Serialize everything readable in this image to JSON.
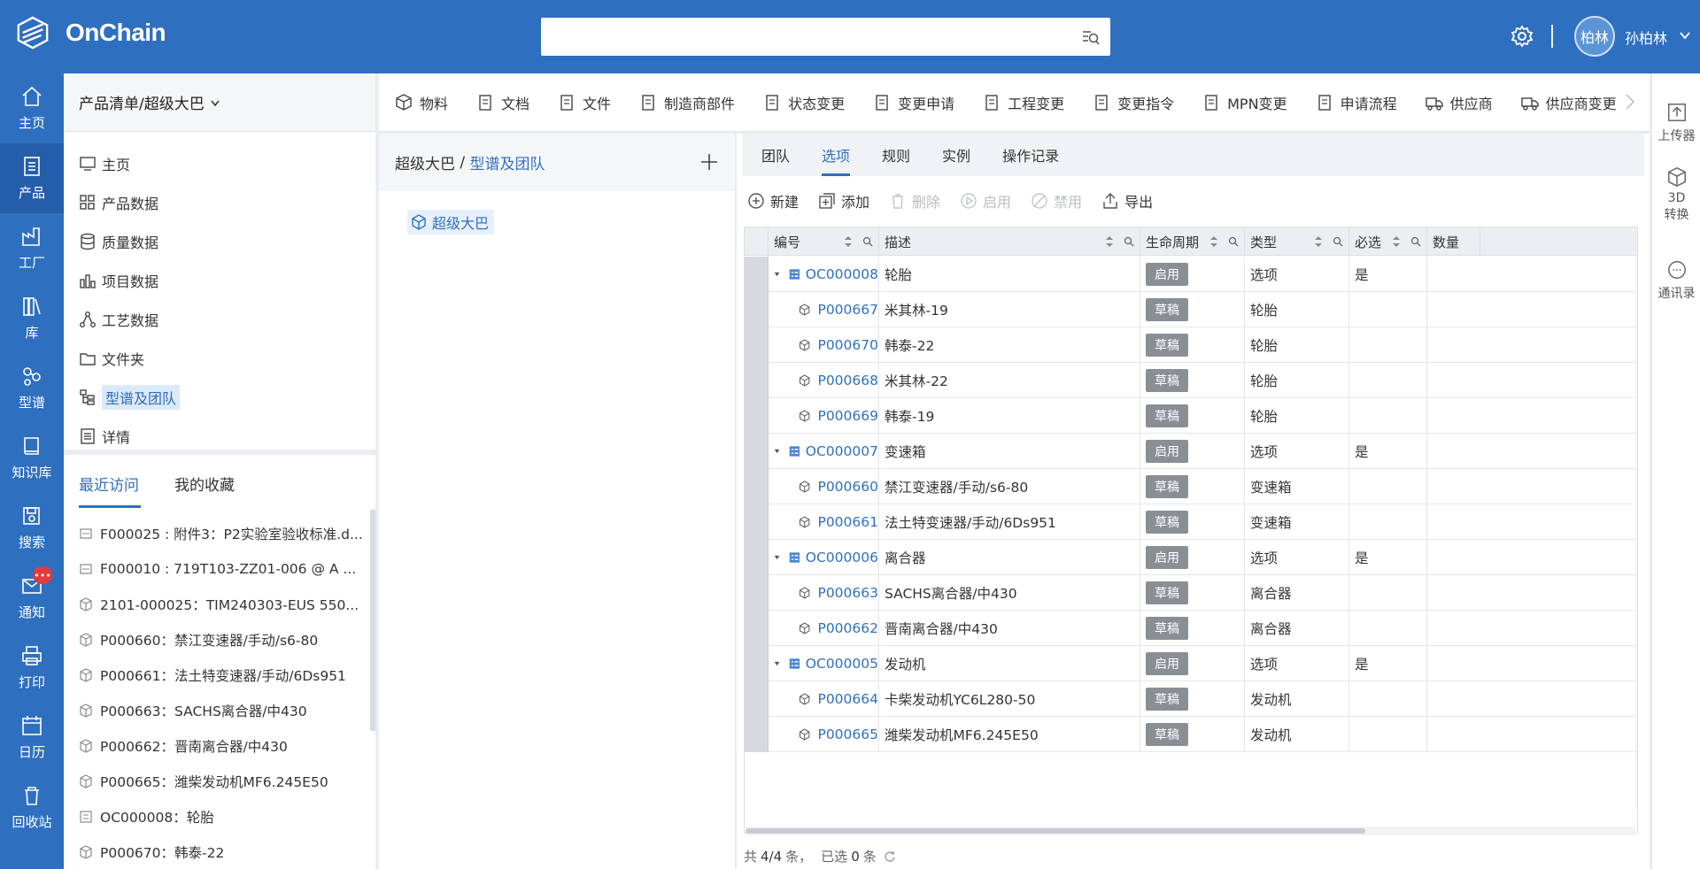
{
  "app": {
    "name": "OnChain"
  },
  "search": {
    "placeholder": ""
  },
  "user": {
    "avatar_text": "柏林",
    "name": "孙柏林"
  },
  "nav_rail": [
    {
      "label": "主页",
      "icon": "home-icon"
    },
    {
      "label": "产品",
      "icon": "product-icon"
    },
    {
      "label": "工厂",
      "icon": "factory-icon"
    },
    {
      "label": "库",
      "icon": "library-icon"
    },
    {
      "label": "型谱",
      "icon": "spectrum-icon"
    },
    {
      "label": "知识库",
      "icon": "book-icon"
    },
    {
      "label": "搜索",
      "icon": "search-save-icon"
    },
    {
      "label": "通知",
      "icon": "mail-icon"
    },
    {
      "label": "打印",
      "icon": "printer-icon"
    },
    {
      "label": "日历",
      "icon": "calendar-icon"
    },
    {
      "label": "回收站",
      "icon": "trash-icon"
    }
  ],
  "notification_badge": "•••",
  "sidebar": {
    "header": "产品清单/超级大巴",
    "items": [
      {
        "label": "主页"
      },
      {
        "label": "产品数据"
      },
      {
        "label": "质量数据"
      },
      {
        "label": "项目数据"
      },
      {
        "label": "工艺数据"
      },
      {
        "label": "文件夹"
      },
      {
        "label": "型谱及团队"
      },
      {
        "label": "详情"
      }
    ],
    "recent_tabs": [
      "最近访问",
      "我的收藏"
    ],
    "recent": [
      "F000025 : 附件3：P2实验室验收标准.d...",
      "F000010 : 719T103-ZZ01-006 @ A ...",
      "2101-000025：TIM240303-EUS 550...",
      "P000660：禁江变速器/手动/s6-80",
      "P000661：法土特变速器/手动/6Ds951",
      "P000663：SACHS离合器/中430",
      "P000662：晋南离合器/中430",
      "P000665：潍柴发动机MF6.245E50",
      "OC000008：轮胎",
      "P000670：韩泰-22"
    ]
  },
  "toolbar": [
    "物料",
    "文档",
    "文件",
    "制造商部件",
    "状态变更",
    "变更申请",
    "工程变更",
    "变更指令",
    "MPN变更",
    "申请流程",
    "供应商",
    "供应商变更"
  ],
  "breadcrumb": {
    "root": "超级大巴",
    "sep": " / ",
    "current": "型谱及团队"
  },
  "tree": {
    "node": "超级大巴"
  },
  "tabs": [
    "团队",
    "选项",
    "规则",
    "实例",
    "操作记录"
  ],
  "actions": [
    {
      "label": "新建",
      "enabled": true
    },
    {
      "label": "添加",
      "enabled": true
    },
    {
      "label": "删除",
      "enabled": false
    },
    {
      "label": "启用",
      "enabled": false
    },
    {
      "label": "禁用",
      "enabled": false
    },
    {
      "label": "导出",
      "enabled": true
    }
  ],
  "columns": [
    "编号",
    "描述",
    "生命周期",
    "类型",
    "必选",
    "数量"
  ],
  "rows": [
    {
      "kind": "option",
      "code": "OC000008",
      "desc": "轮胎",
      "state": "启用",
      "type": "选项",
      "required": "是"
    },
    {
      "kind": "part",
      "code": "P000667",
      "desc": "米其林-19",
      "state": "草稿",
      "type": "轮胎",
      "required": ""
    },
    {
      "kind": "part",
      "code": "P000670",
      "desc": "韩泰-22",
      "state": "草稿",
      "type": "轮胎",
      "required": ""
    },
    {
      "kind": "part",
      "code": "P000668",
      "desc": "米其林-22",
      "state": "草稿",
      "type": "轮胎",
      "required": ""
    },
    {
      "kind": "part",
      "code": "P000669",
      "desc": "韩泰-19",
      "state": "草稿",
      "type": "轮胎",
      "required": ""
    },
    {
      "kind": "option",
      "code": "OC000007",
      "desc": "变速箱",
      "state": "启用",
      "type": "选项",
      "required": "是"
    },
    {
      "kind": "part",
      "code": "P000660",
      "desc": "禁江变速器/手动/s6-80",
      "state": "草稿",
      "type": "变速箱",
      "required": ""
    },
    {
      "kind": "part",
      "code": "P000661",
      "desc": "法土特变速器/手动/6Ds951",
      "state": "草稿",
      "type": "变速箱",
      "required": ""
    },
    {
      "kind": "option",
      "code": "OC000006",
      "desc": "离合器",
      "state": "启用",
      "type": "选项",
      "required": "是"
    },
    {
      "kind": "part",
      "code": "P000663",
      "desc": "SACHS离合器/中430",
      "state": "草稿",
      "type": "离合器",
      "required": ""
    },
    {
      "kind": "part",
      "code": "P000662",
      "desc": "晋南离合器/中430",
      "state": "草稿",
      "type": "离合器",
      "required": ""
    },
    {
      "kind": "option",
      "code": "OC000005",
      "desc": "发动机",
      "state": "启用",
      "type": "选项",
      "required": "是"
    },
    {
      "kind": "part",
      "code": "P000664",
      "desc": "卡柴发动机YC6L280-50",
      "state": "草稿",
      "type": "发动机",
      "required": ""
    },
    {
      "kind": "part",
      "code": "P000665",
      "desc": "潍柴发动机MF6.245E50",
      "state": "草稿",
      "type": "发动机",
      "required": ""
    }
  ],
  "footer": {
    "total_prefix": "共",
    "total": "4/4",
    "total_suffix": "条，",
    "selected_prefix": "已选",
    "selected": "0",
    "selected_suffix": "条"
  },
  "right_rail": [
    {
      "label": "上传器",
      "icon": "upload-icon"
    },
    {
      "label": "3D\n转换",
      "icon": "cube-icon"
    },
    {
      "label": "通讯录",
      "icon": "chat-icon"
    }
  ]
}
